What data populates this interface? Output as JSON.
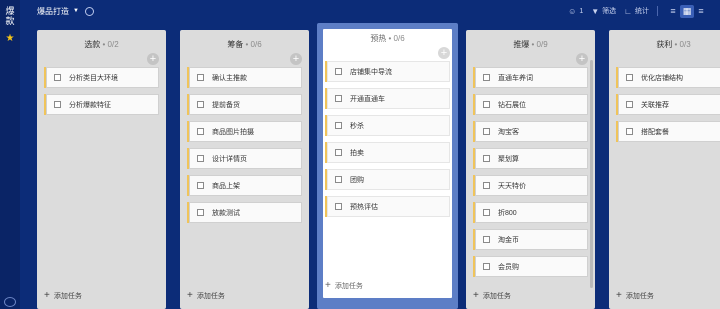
{
  "rail": {
    "title": "爆款"
  },
  "topbar": {
    "project_name": "爆品打造",
    "members_count": "1",
    "filter_label": "筛选",
    "stats_label": "统计"
  },
  "columns": [
    {
      "title": "选款",
      "count": " • 0/2",
      "cards": [
        "分析类目大环境",
        "分析爆款特征"
      ],
      "add_task": "添加任务"
    },
    {
      "title": "筹备",
      "count": " • 0/6",
      "cards": [
        "确认主推款",
        "提前备货",
        "商品图片拍摄",
        "设计详情页",
        "商品上架",
        "放款测试"
      ],
      "add_task": "添加任务"
    },
    {
      "title": "预热",
      "count": " • 0/6",
      "cards": [
        "店铺集中导流",
        "开通直通车",
        "秒杀",
        "拍卖",
        "团购",
        "预热评估"
      ],
      "add_task": "添加任务"
    },
    {
      "title": "推爆",
      "count": " • 0/9",
      "cards": [
        "直通车养词",
        "钻石展位",
        "淘宝客",
        "聚划算",
        "天天特价",
        "折800",
        "淘金币",
        "会员购"
      ],
      "add_task": "添加任务"
    },
    {
      "title": "获利",
      "count": " • 0/3",
      "cards": [
        "优化店铺结构",
        "关联推荐",
        "搭配套餐"
      ],
      "add_task": "添加任务"
    }
  ]
}
